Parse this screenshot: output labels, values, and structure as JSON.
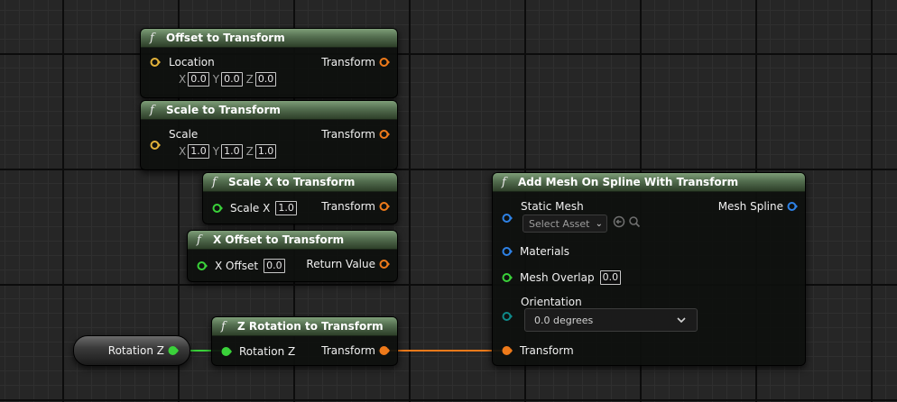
{
  "nodes": {
    "offset": {
      "title": "Offset to Transform",
      "input_label": "Location",
      "output_label": "Transform",
      "x_label": "X",
      "x_value": "0.0",
      "y_label": "Y",
      "y_value": "0.0",
      "z_label": "Z",
      "z_value": "0.0"
    },
    "scale": {
      "title": "Scale to Transform",
      "input_label": "Scale",
      "output_label": "Transform",
      "x_label": "X",
      "x_value": "1.0",
      "y_label": "Y",
      "y_value": "1.0",
      "z_label": "Z",
      "z_value": "1.0"
    },
    "scale_x": {
      "title": "Scale X to Transform",
      "input_label": "Scale X",
      "input_value": "1.0",
      "output_label": "Transform"
    },
    "x_offset": {
      "title": "X Offset to Transform",
      "input_label": "X Offset",
      "input_value": "0.0",
      "output_label": "Return Value"
    },
    "z_rotation": {
      "title": "Z Rotation to Transform",
      "input_label": "Rotation Z",
      "output_label": "Transform"
    },
    "rotation_var": {
      "label": "Rotation Z"
    },
    "add_mesh": {
      "title": "Add Mesh On Spline With Transform",
      "static_mesh_label": "Static Mesh",
      "asset_placeholder": "Select Asset",
      "output_label": "Mesh Spline",
      "materials_label": "Materials",
      "mesh_overlap_label": "Mesh Overlap",
      "mesh_overlap_value": "0.0",
      "orientation_label": "Orientation",
      "orientation_value": "0.0 degrees",
      "transform_label": "Transform"
    }
  },
  "icons": {
    "function": "f",
    "dropdown": "⌄"
  },
  "colors": {
    "vector_pin": "#e2b23a",
    "transform_pin": "#ee7a1a",
    "float_pin": "#3ad23a",
    "object_pin": "#2e82e6",
    "enum_pin": "#0f8a8a",
    "node_header": "#536d4f"
  }
}
